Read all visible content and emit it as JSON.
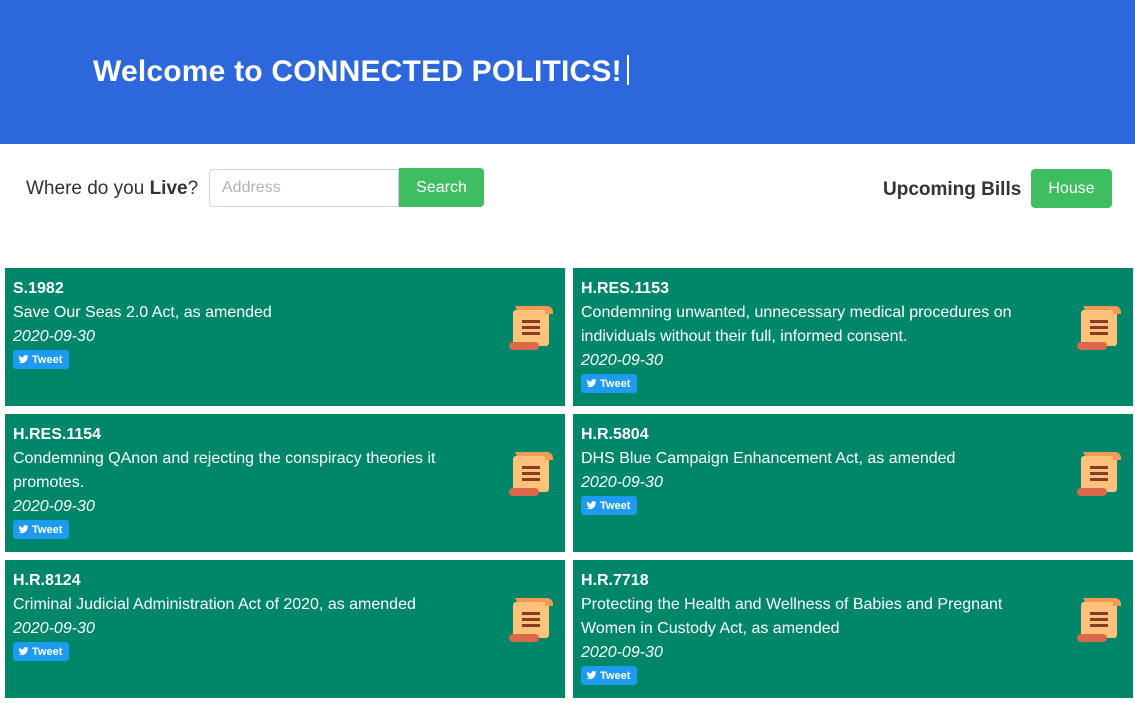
{
  "header": {
    "title": "Welcome to CONNECTED POLITICS!"
  },
  "search": {
    "label_prefix": "Where do you ",
    "label_bold": "Live",
    "label_suffix": "?",
    "placeholder": "Address",
    "button_label": "Search"
  },
  "upcoming": {
    "label": "Upcoming Bills",
    "chamber_button": "House"
  },
  "bills": [
    {
      "id": "S.1982",
      "title": "Save Our Seas 2.0 Act, as amended",
      "date": "2020-09-30",
      "tweet": "Tweet",
      "icon": "scroll-icon"
    },
    {
      "id": "H.RES.1153",
      "title": "Condemning unwanted, unnecessary medical procedures on individuals without their full, informed consent.",
      "date": "2020-09-30",
      "tweet": "Tweet",
      "icon": "scroll-icon"
    },
    {
      "id": "H.RES.1154",
      "title": "Condemning QAnon and rejecting the conspiracy theories it promotes.",
      "date": "2020-09-30",
      "tweet": "Tweet",
      "icon": "scroll-icon"
    },
    {
      "id": "H.R.5804",
      "title": "DHS Blue Campaign Enhancement Act, as amended",
      "date": "2020-09-30",
      "tweet": "Tweet",
      "icon": "scroll-icon"
    },
    {
      "id": "H.R.8124",
      "title": "Criminal Judicial Administration Act of 2020, as amended",
      "date": "2020-09-30",
      "tweet": "Tweet",
      "icon": "scroll-icon"
    },
    {
      "id": "H.R.7718",
      "title": "Protecting the Health and Wellness of Babies and Pregnant Women in Custody Act, as amended",
      "date": "2020-09-30",
      "tweet": "Tweet",
      "icon": "scroll-icon"
    }
  ],
  "colors": {
    "header_bg": "#2c67dc",
    "card_bg": "#00876a",
    "button_green": "#3fbe61",
    "tweet_blue": "#1d9bf0"
  }
}
